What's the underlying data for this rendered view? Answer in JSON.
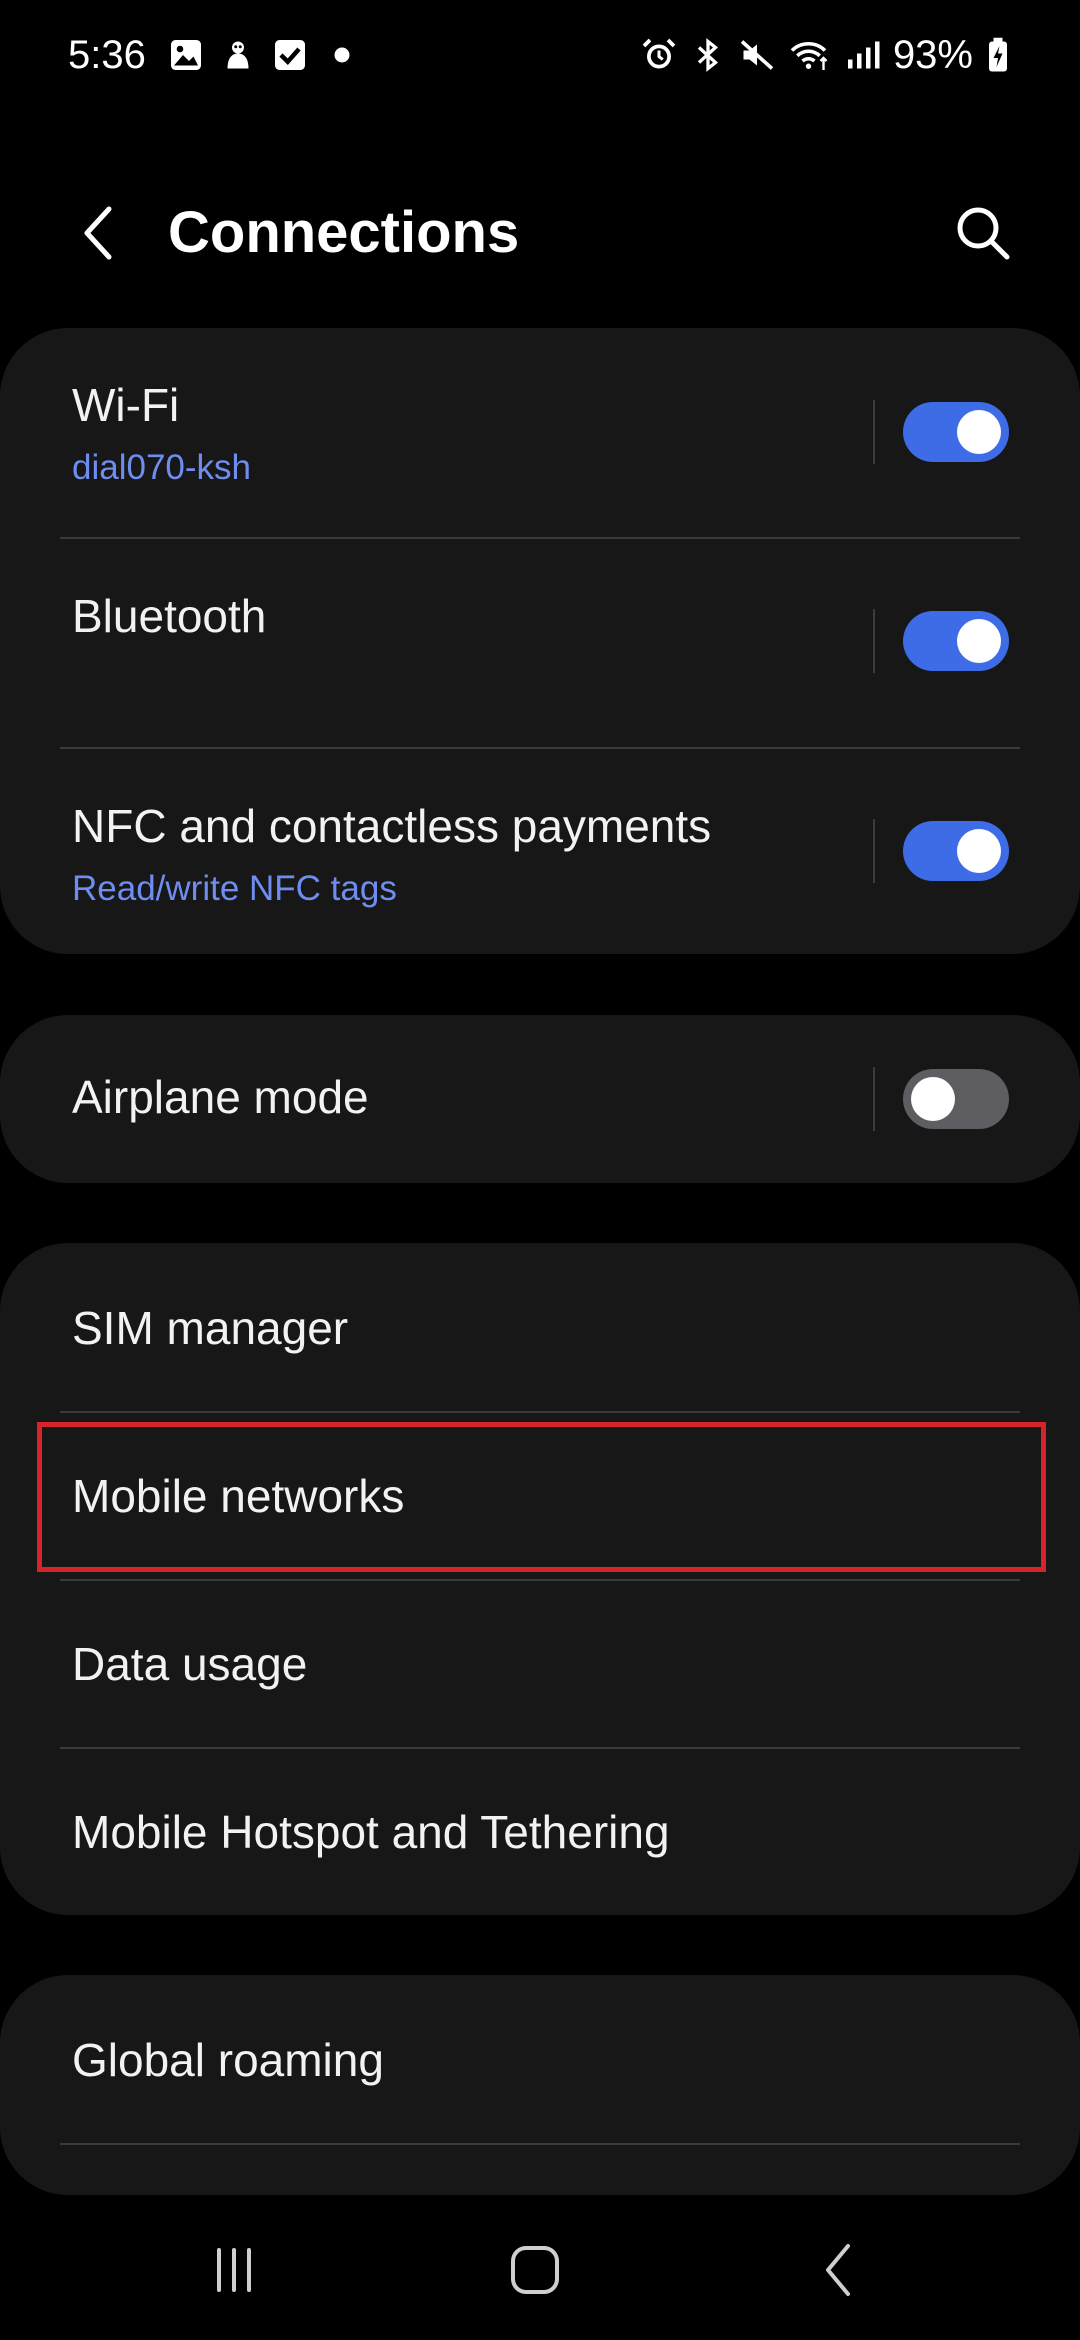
{
  "status_bar": {
    "time": "5:36",
    "left_icons": [
      "gallery-icon",
      "notification-app-icon",
      "task-check-icon",
      "dot-icon"
    ],
    "right_icons": [
      "alarm-icon",
      "bluetooth-icon",
      "mute-icon",
      "wifi-icon",
      "signal-icon",
      "battery-charging-icon"
    ],
    "battery": "93%"
  },
  "header": {
    "title": "Connections"
  },
  "groups": {
    "wireless": {
      "wifi": {
        "title": "Wi-Fi",
        "subtitle": "dial070-ksh",
        "enabled": true
      },
      "bluetooth": {
        "title": "Bluetooth",
        "enabled": true
      },
      "nfc": {
        "title": "NFC and contactless payments",
        "subtitle": "Read/write NFC tags",
        "enabled": true
      }
    },
    "airplane": {
      "airplane_mode": {
        "title": "Airplane mode",
        "enabled": false
      }
    },
    "mobile": {
      "sim_manager": "SIM manager",
      "mobile_networks": "Mobile networks",
      "data_usage": "Data usage",
      "hotspot": "Mobile Hotspot and Tethering"
    },
    "roaming": {
      "global_roaming": "Global roaming"
    }
  },
  "colors": {
    "background": "#000000",
    "card": "#171717",
    "accent": "#3e6ce6",
    "subtitle": "#6f8df0",
    "highlight": "#d9232b"
  }
}
